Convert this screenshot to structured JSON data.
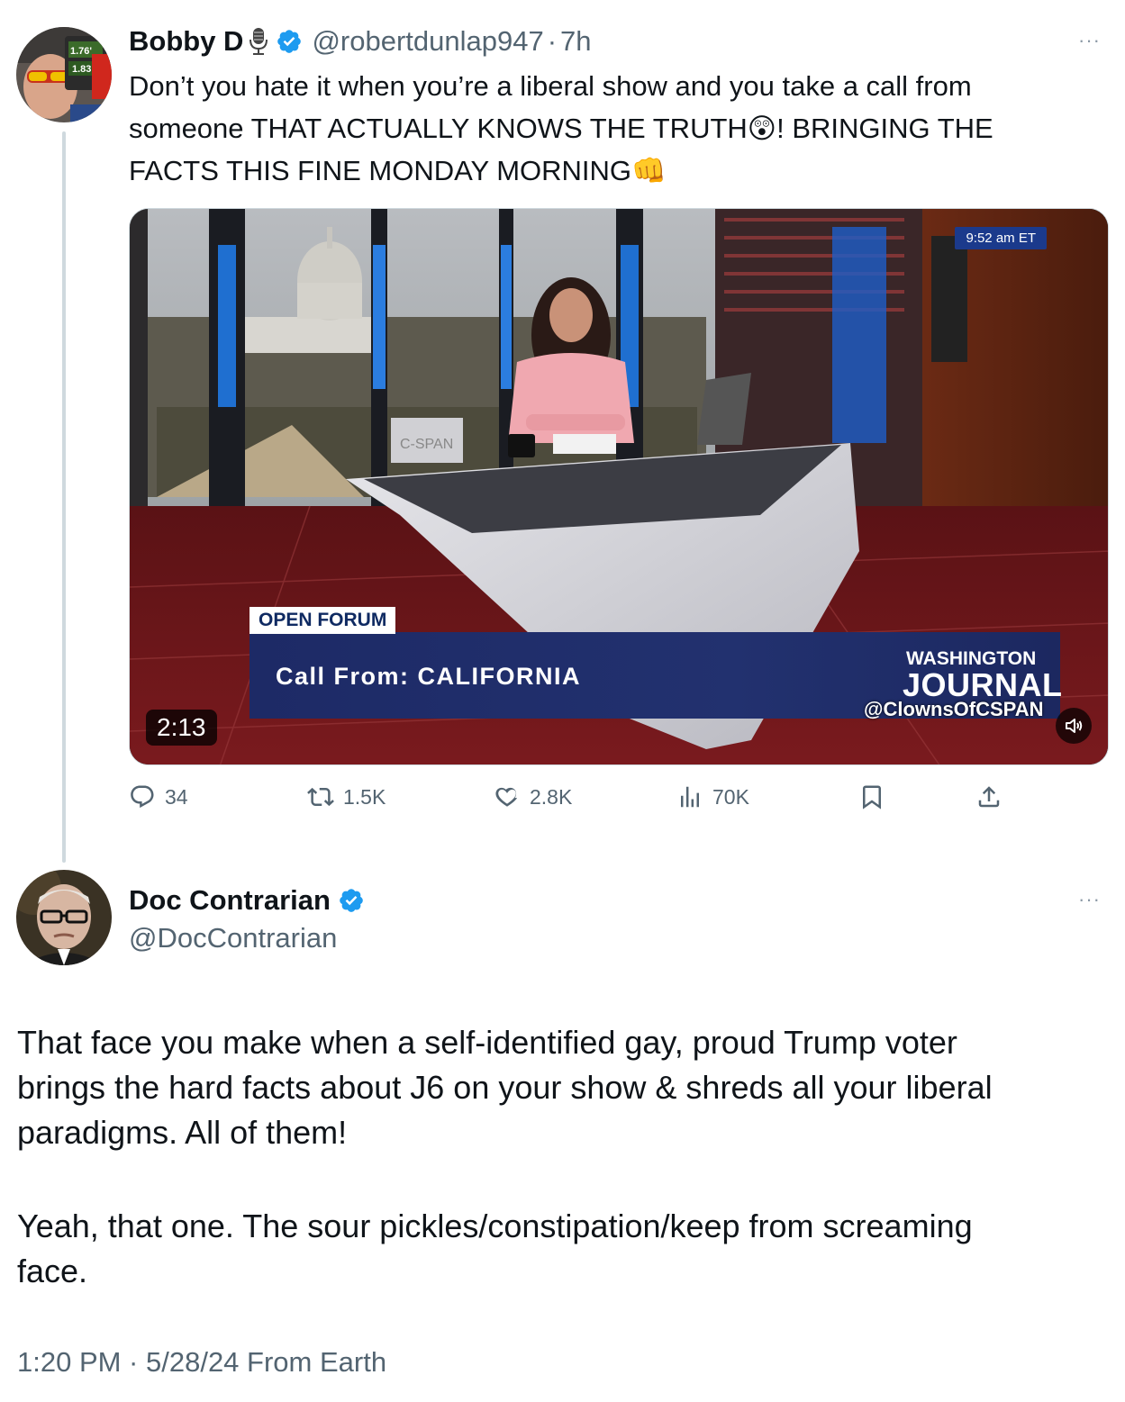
{
  "tweet1": {
    "name": "Bobby D",
    "handle": "@robertdunlap947",
    "separator": "·",
    "time": "7h",
    "more": "···",
    "text_line1": "Don’t you hate it when you’re a liberal show and you take a call from",
    "text_line2a": "someone THAT ACTUALLY KNOWS THE TRUTH",
    "text_emoji1": "😲",
    "text_line2b": "! BRINGING THE",
    "text_line3": "FACTS THIS FINE MONDAY MORNING",
    "text_emoji2": "👊",
    "avatar_text1": "1.76'",
    "avatar_text2": "1.83'",
    "video": {
      "duration": "2:13",
      "time_bug": "9:52 am ET",
      "open_forum": "OPEN FORUM",
      "call_from": "Call From:  CALIFORNIA",
      "brand_line1": "WASHINGTON",
      "brand_line2": "JOURNAL",
      "watermark": "@ClownsOfCSPAN",
      "desk_logo": "C-SPAN"
    },
    "actions": {
      "replies": "34",
      "reposts": "1.5K",
      "likes": "2.8K",
      "views": "70K"
    }
  },
  "tweet2": {
    "name": "Doc Contrarian",
    "handle": "@DocContrarian",
    "more": "···",
    "text_p1_line1": "That face you make when a self-identified gay, proud Trump voter",
    "text_p1_line2": "brings the hard facts about J6 on your show & shreds all your liberal",
    "text_p1_line3": "paradigms. All of them!",
    "text_p2_line1": "Yeah, that one. The sour pickles/constipation/keep from screaming",
    "text_p2_line2": "face.",
    "meta": "1:20 PM · 5/28/24 From Earth"
  },
  "colors": {
    "verified": "#1d9bf0",
    "secondary_text": "#536471",
    "thread_line": "#cfd9de"
  }
}
